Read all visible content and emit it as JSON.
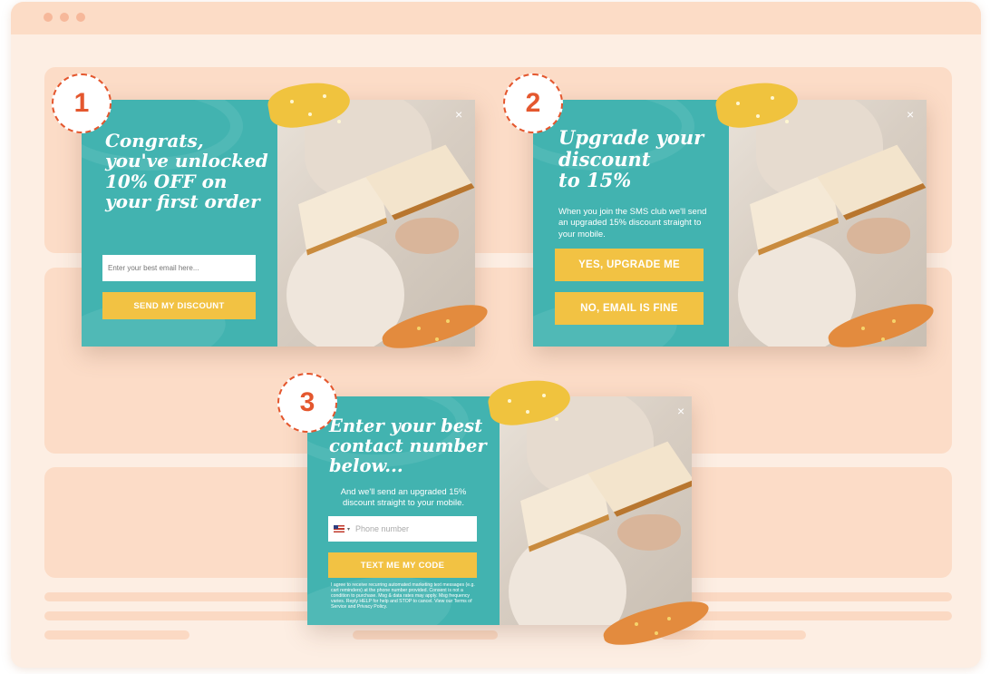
{
  "colors": {
    "teal": "#42b3b0",
    "yellow": "#f2c243",
    "orange_badge": "#e4572e",
    "page_bg": "#fdeee3"
  },
  "icons": [
    "close-icon",
    "us-flag-icon",
    "chevron-down-icon"
  ],
  "popup1": {
    "badge": "1",
    "headline_lines": [
      "Congrats,",
      "you've unlocked",
      "10% OFF on",
      "your first order"
    ],
    "email_placeholder": "Enter your best email here...",
    "button": "SEND MY DISCOUNT",
    "close": "×"
  },
  "popup2": {
    "badge": "2",
    "headline_lines": [
      "Upgrade your",
      "discount",
      "to 15%"
    ],
    "subtext": "When you join the SMS club we'll send an upgraded 15% discount straight to your mobile.",
    "yes_button": "YES, UPGRADE ME",
    "no_button": "NO, EMAIL IS FINE",
    "close": "×"
  },
  "popup3": {
    "badge": "3",
    "headline_lines": [
      "Enter your best",
      "contact number",
      "below..."
    ],
    "subtext": "And we'll send an upgraded 15% discount straight to your mobile.",
    "phone_placeholder": "Phone number",
    "button": "TEXT ME MY CODE",
    "legal": "I agree to receive recurring automated marketing text messages (e.g. cart reminders) at the phone number provided. Consent is not a condition to purchase. Msg & data rates may apply. Msg frequency varies. Reply HELP for help and STOP to cancel. View our Terms of Service and Privacy Policy.",
    "close": "×"
  }
}
